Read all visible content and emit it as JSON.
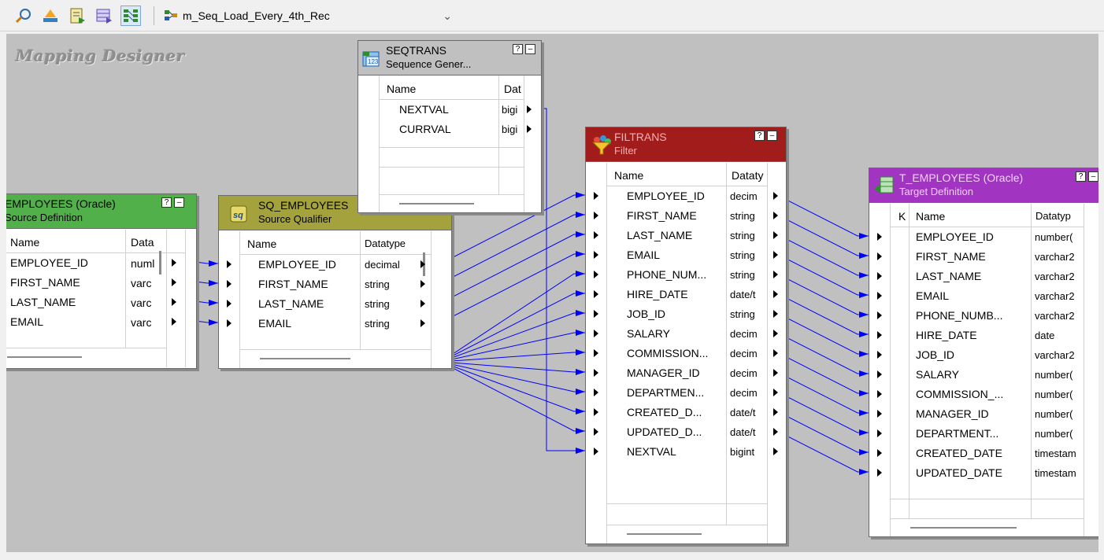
{
  "toolbar": {
    "buttons": [
      {
        "icon": "connect-icon"
      },
      {
        "icon": "arrange-icon"
      },
      {
        "icon": "import-icon"
      },
      {
        "icon": "table-view-icon"
      },
      {
        "icon": "link-ports-icon"
      }
    ],
    "mapping_name": "m_Seq_Load_Every_4th_Rec"
  },
  "canvas": {
    "title": "Mapping Designer",
    "background": "#c0c0c0",
    "link_color": "#0000ff"
  },
  "source_def": {
    "title": "EMPLOYEES (Oracle)",
    "subtitle": "Source Definition",
    "header_color": "#4caf50",
    "col_name": "Name",
    "col_type": "Data",
    "rows": [
      {
        "name": "EMPLOYEE_ID",
        "type": "numl"
      },
      {
        "name": "FIRST_NAME",
        "type": "varc"
      },
      {
        "name": "LAST_NAME",
        "type": "varc"
      },
      {
        "name": "EMAIL",
        "type": "varc"
      }
    ]
  },
  "source_qualifier": {
    "title": "SQ_EMPLOYEES",
    "subtitle": "Source Qualifier",
    "header_color": "#9d9b2e",
    "col_name": "Name",
    "col_type": "Datatype",
    "rows": [
      {
        "name": "EMPLOYEE_ID",
        "type": "decimal"
      },
      {
        "name": "FIRST_NAME",
        "type": "string"
      },
      {
        "name": "LAST_NAME",
        "type": "string"
      },
      {
        "name": "EMAIL",
        "type": "string"
      }
    ]
  },
  "seqtrans": {
    "title": "SEQTRANS",
    "subtitle": "Sequence Gener...",
    "header_color": "#bdbdbd",
    "col_name": "Name",
    "col_type": "Dat",
    "rows": [
      {
        "name": "NEXTVAL",
        "type": "bigi"
      },
      {
        "name": "CURRVAL",
        "type": "bigi"
      }
    ]
  },
  "filtrans": {
    "title": "FILTRANS",
    "subtitle": "Filter",
    "header_color": "#9c1c1c",
    "col_name": "Name",
    "col_type": "Dataty",
    "rows": [
      {
        "name": "EMPLOYEE_ID",
        "type": "decim"
      },
      {
        "name": "FIRST_NAME",
        "type": "string"
      },
      {
        "name": "LAST_NAME",
        "type": "string"
      },
      {
        "name": "EMAIL",
        "type": "string"
      },
      {
        "name": "PHONE_NUM...",
        "type": "string"
      },
      {
        "name": "HIRE_DATE",
        "type": "date/t"
      },
      {
        "name": "JOB_ID",
        "type": "string"
      },
      {
        "name": "SALARY",
        "type": "decim"
      },
      {
        "name": "COMMISSION...",
        "type": "decim"
      },
      {
        "name": "MANAGER_ID",
        "type": "decim"
      },
      {
        "name": "DEPARTMEN...",
        "type": "decim"
      },
      {
        "name": "CREATED_D...",
        "type": "date/t"
      },
      {
        "name": "UPDATED_D...",
        "type": "date/t"
      },
      {
        "name": "NEXTVAL",
        "type": "bigint"
      }
    ]
  },
  "target": {
    "title": "T_EMPLOYEES (Oracle)",
    "subtitle": "Target Definition",
    "header_color": "#9c33b8",
    "col_key": "K",
    "col_name": "Name",
    "col_type": "Datatyp",
    "rows": [
      {
        "name": "EMPLOYEE_ID",
        "type": "number("
      },
      {
        "name": "FIRST_NAME",
        "type": "varchar2"
      },
      {
        "name": "LAST_NAME",
        "type": "varchar2"
      },
      {
        "name": "EMAIL",
        "type": "varchar2"
      },
      {
        "name": "PHONE_NUMB...",
        "type": "varchar2"
      },
      {
        "name": "HIRE_DATE",
        "type": "date"
      },
      {
        "name": "JOB_ID",
        "type": "varchar2"
      },
      {
        "name": "SALARY",
        "type": "number("
      },
      {
        "name": "COMMISSION_...",
        "type": "number("
      },
      {
        "name": "MANAGER_ID",
        "type": "number("
      },
      {
        "name": "DEPARTMENT...",
        "type": "number("
      },
      {
        "name": "CREATED_DATE",
        "type": "timestam"
      },
      {
        "name": "UPDATED_DATE",
        "type": "timestam"
      }
    ]
  }
}
